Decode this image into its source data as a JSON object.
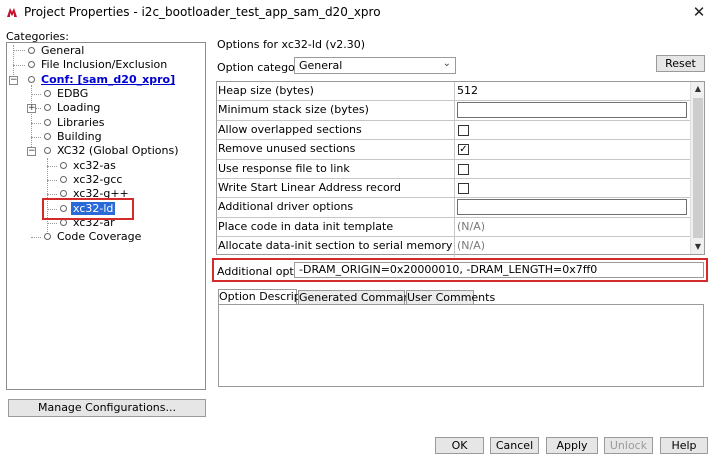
{
  "window": {
    "title": "Project Properties - i2c_bootloader_test_app_sam_d20_xpro",
    "close_glyph": "✕"
  },
  "left": {
    "categories_label": "Categories:",
    "tree": [
      {
        "label": "General"
      },
      {
        "label": "File Inclusion/Exclusion"
      },
      {
        "label": "Conf: [sam_d20_xpro]",
        "expander": "−"
      },
      {
        "label": "EDBG"
      },
      {
        "label": "Loading",
        "expander": "+"
      },
      {
        "label": "Libraries"
      },
      {
        "label": "Building"
      },
      {
        "label": "XC32 (Global Options)",
        "expander": "−"
      },
      {
        "label": "xc32-as"
      },
      {
        "label": "xc32-gcc"
      },
      {
        "label": "xc32-g++"
      },
      {
        "label": "xc32-ld"
      },
      {
        "label": "xc32-ar"
      },
      {
        "label": "Code Coverage"
      }
    ],
    "manage_button": "Manage Configurations..."
  },
  "right": {
    "options_for": "Options for xc32-ld (v2.30)",
    "option_categories_label": "Option categories:",
    "option_categories_value": "General",
    "dropdown_glyph": "⌄",
    "reset_button": "Reset",
    "properties": [
      {
        "name": "Heap size (bytes)",
        "value": "512"
      },
      {
        "name": "Minimum stack size (bytes)",
        "value": ""
      },
      {
        "name": "Allow overlapped sections",
        "value": ""
      },
      {
        "name": "Remove unused sections",
        "value": "✓"
      },
      {
        "name": "Use response file to link",
        "value": ""
      },
      {
        "name": "Write Start Linear Address record",
        "value": ""
      },
      {
        "name": "Additional driver options",
        "value": ""
      },
      {
        "name": "Place code in data init template",
        "value": "(N/A)"
      },
      {
        "name": "Allocate data-init section to serial memory",
        "value": "(N/A)"
      }
    ],
    "scroll_up_glyph": "▲",
    "scroll_down_glyph": "▼",
    "additional_options_label": "Additional options:",
    "additional_options_value": "-DRAM_ORIGIN=0x20000010, -DRAM_LENGTH=0x7ff0",
    "tabs": [
      "Option Description",
      "Generated Command Line",
      "User Comments"
    ]
  },
  "buttons": {
    "ok": "OK",
    "cancel": "Cancel",
    "apply": "Apply",
    "unlock": "Unlock",
    "help": "Help"
  }
}
